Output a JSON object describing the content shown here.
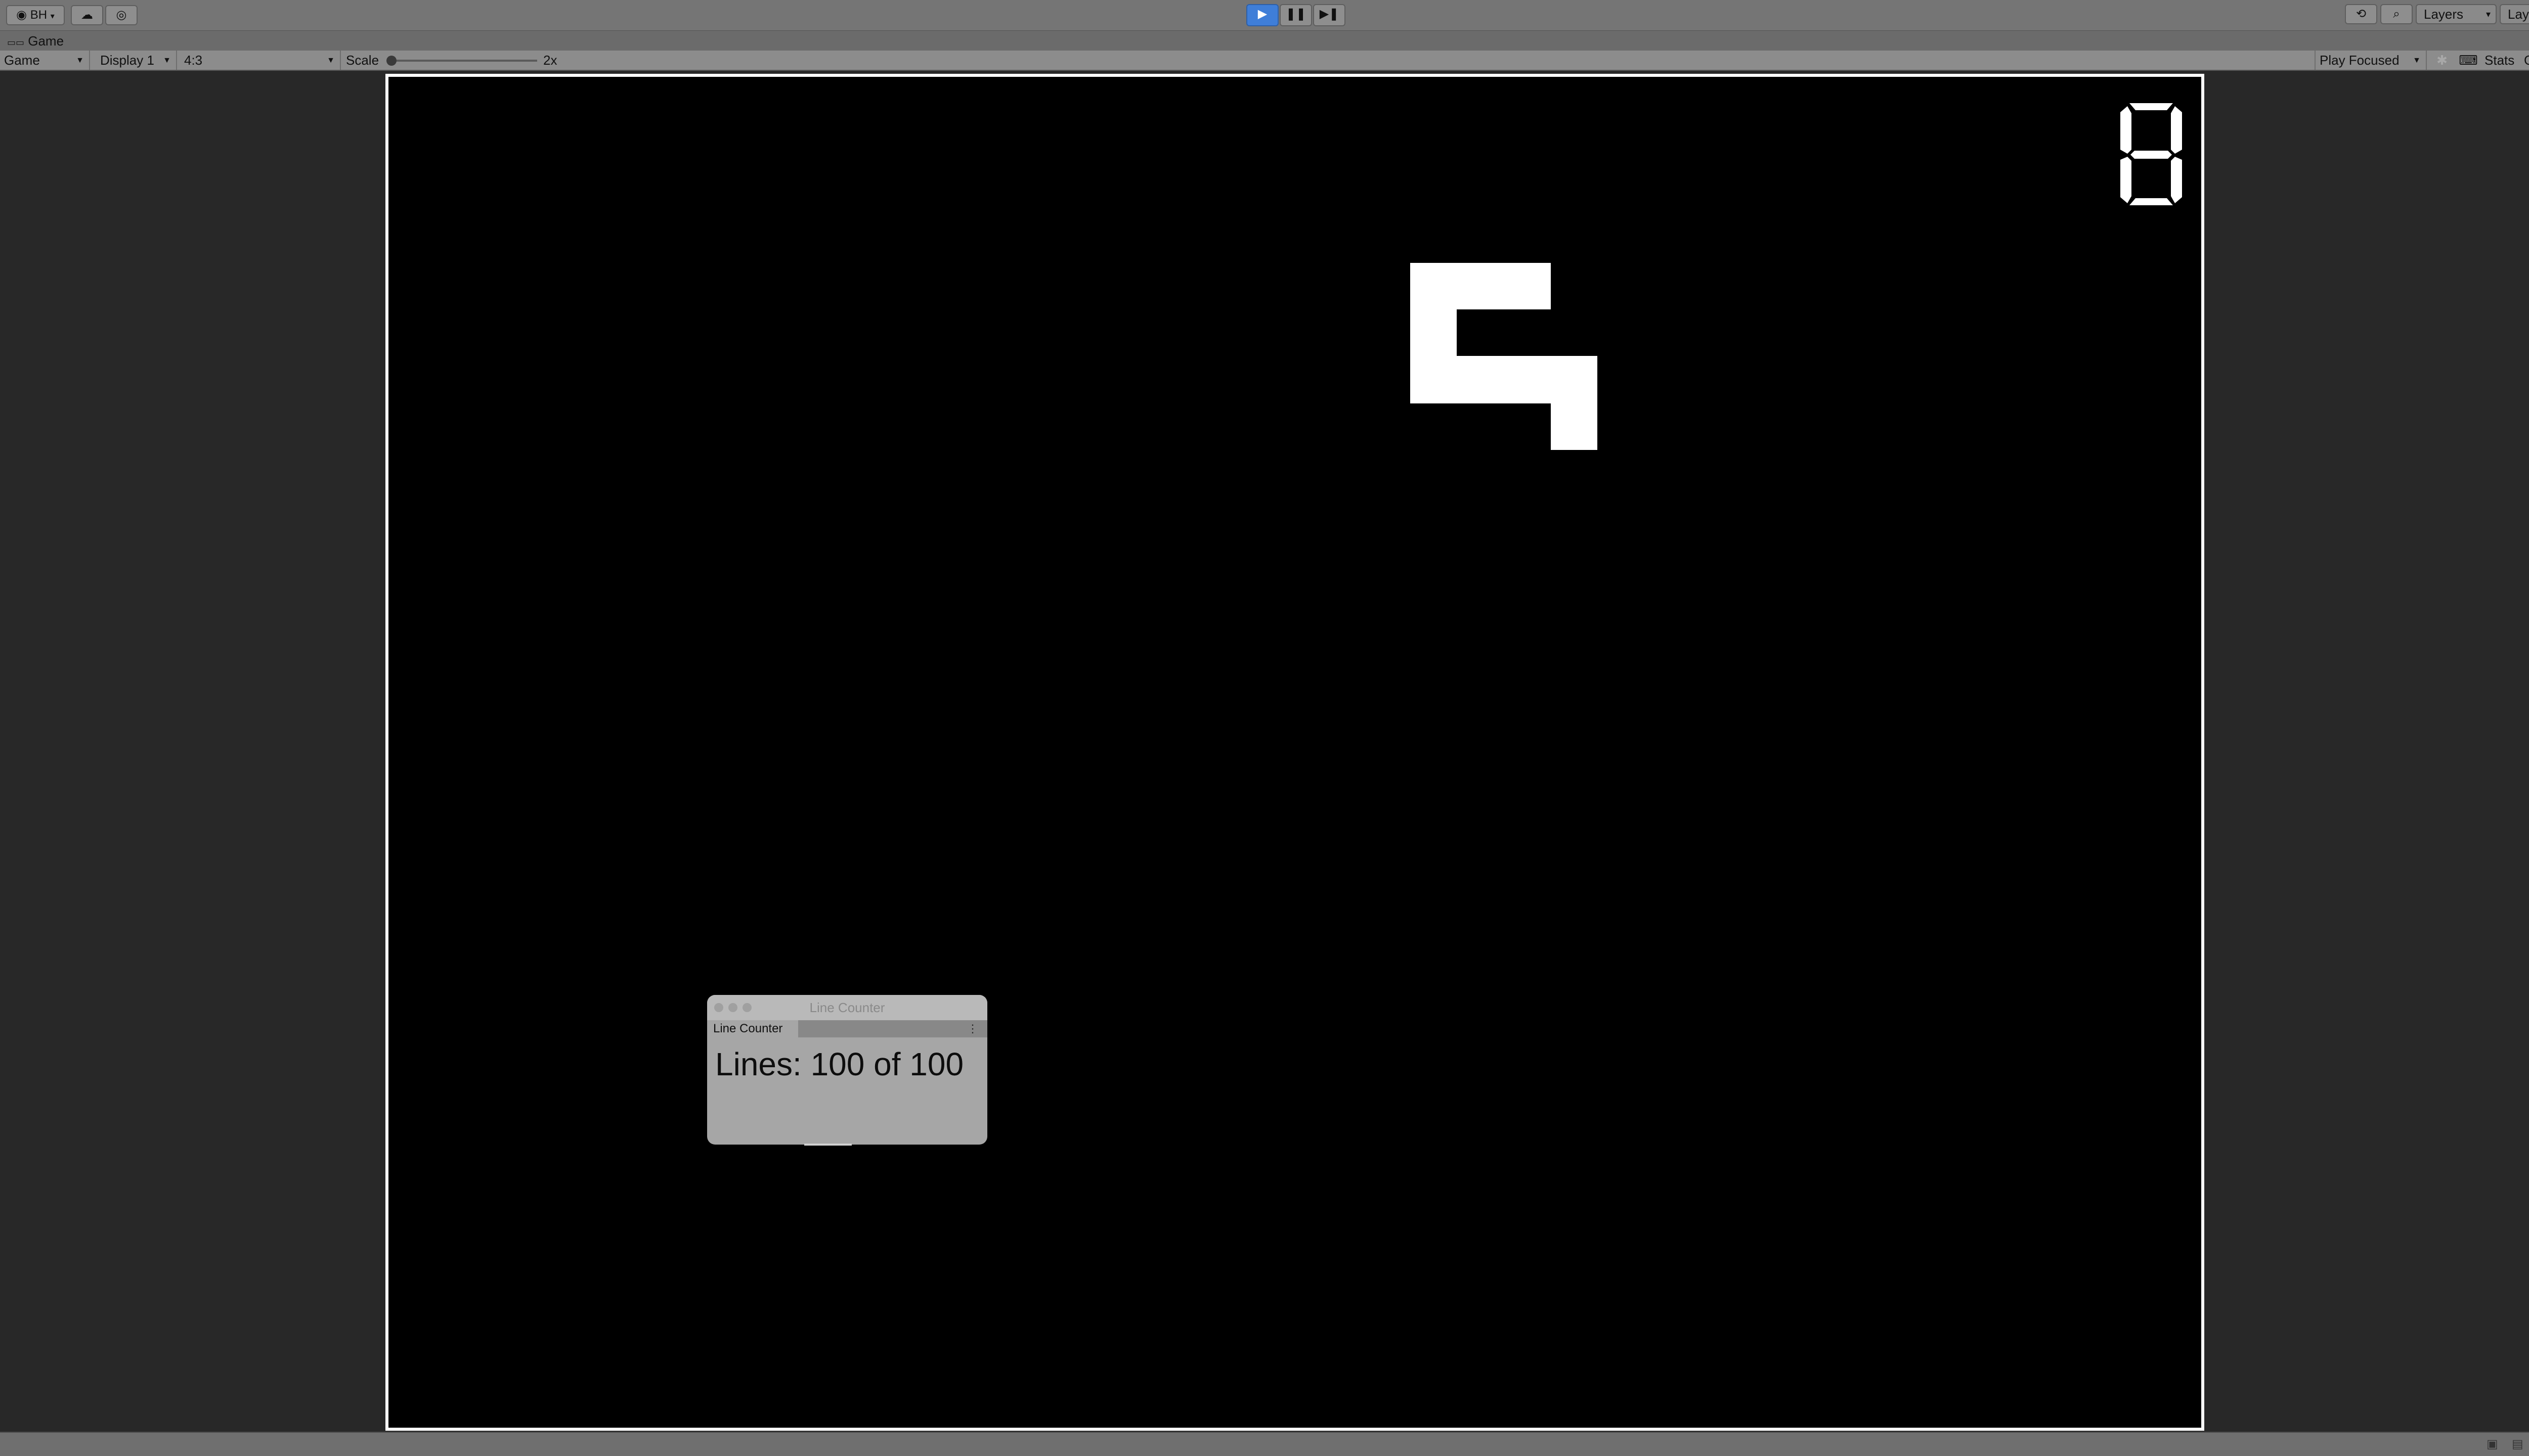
{
  "toolbar": {
    "account_label": "BH",
    "layers_label": "Layers",
    "layout_label": "Layout"
  },
  "tab": {
    "label": "Game"
  },
  "gamebar": {
    "view_mode": "Game",
    "display": "Display 1",
    "aspect": "4:3",
    "scale_label": "Scale",
    "scale_value": "2x",
    "play_focused": "Play Focused",
    "stats_label": "Stats",
    "gizmos_label": "Gizmos"
  },
  "game": {
    "score_digit": "8"
  },
  "line_counter": {
    "window_title": "Line Counter",
    "tab_label": "Line Counter",
    "lines_text": "Lines: 100 of 100"
  },
  "colors": {
    "play_active": "#3f7ed8",
    "game_background": "#000000",
    "game_foreground": "#ffffff"
  }
}
